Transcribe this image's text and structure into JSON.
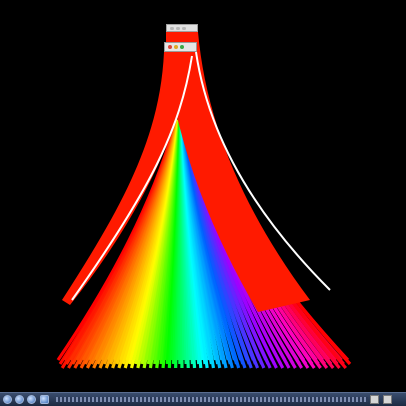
{
  "desktop": {
    "background": "#000000"
  },
  "front_window": {
    "title": "",
    "controls": [
      "close-icon",
      "minimize-icon",
      "maximize-icon"
    ],
    "color": "#ff1a00"
  },
  "top_window": {
    "title": "",
    "color": "#ff2200"
  },
  "cascade": {
    "gradient_colors": [
      "#ff0000",
      "#ff8000",
      "#ffff00",
      "#00ff00",
      "#00ffff",
      "#0060ff",
      "#a000ff",
      "#ff00c0",
      "#ff0000"
    ],
    "outline_color": "#ffffff"
  },
  "taskbar": {
    "launcher_icons": [
      "windows-icon",
      "browser-icon",
      "media-icon",
      "explorer-icon"
    ],
    "tray_icons": [
      "tray-app-icon",
      "tray-window-icon"
    ]
  }
}
